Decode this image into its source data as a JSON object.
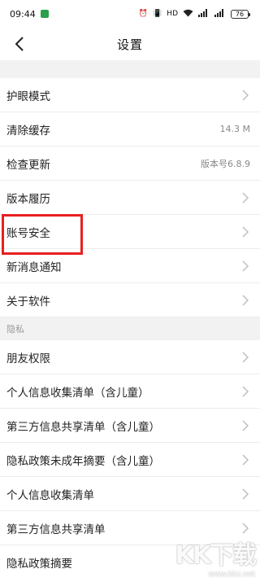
{
  "status_bar": {
    "time": "09:44",
    "battery": "76"
  },
  "header": {
    "title": "设置",
    "back_icon": "chevron-left-icon"
  },
  "settings": {
    "items": [
      {
        "label": "护眼模式"
      },
      {
        "label": "清除缓存",
        "value": "14.3 M"
      },
      {
        "label": "检查更新",
        "value": "版本号6.8.9"
      },
      {
        "label": "版本履历"
      },
      {
        "label": "账号安全"
      },
      {
        "label": "新消息通知"
      },
      {
        "label": "关于软件"
      }
    ]
  },
  "privacy": {
    "section_label": "隐私",
    "items": [
      {
        "label": "朋友权限"
      },
      {
        "label": "个人信息收集清单（含儿童）"
      },
      {
        "label": "第三方信息共享清单（含儿童）"
      },
      {
        "label": "隐私政策未成年摘要（含儿童）"
      },
      {
        "label": "个人信息收集清单"
      },
      {
        "label": "第三方信息共享清单"
      },
      {
        "label": "隐私政策摘要"
      }
    ]
  },
  "annotation": {
    "highlight_color": "#e82020"
  },
  "watermark": {
    "logo": "KK下载",
    "url": "www.kkx.net"
  }
}
